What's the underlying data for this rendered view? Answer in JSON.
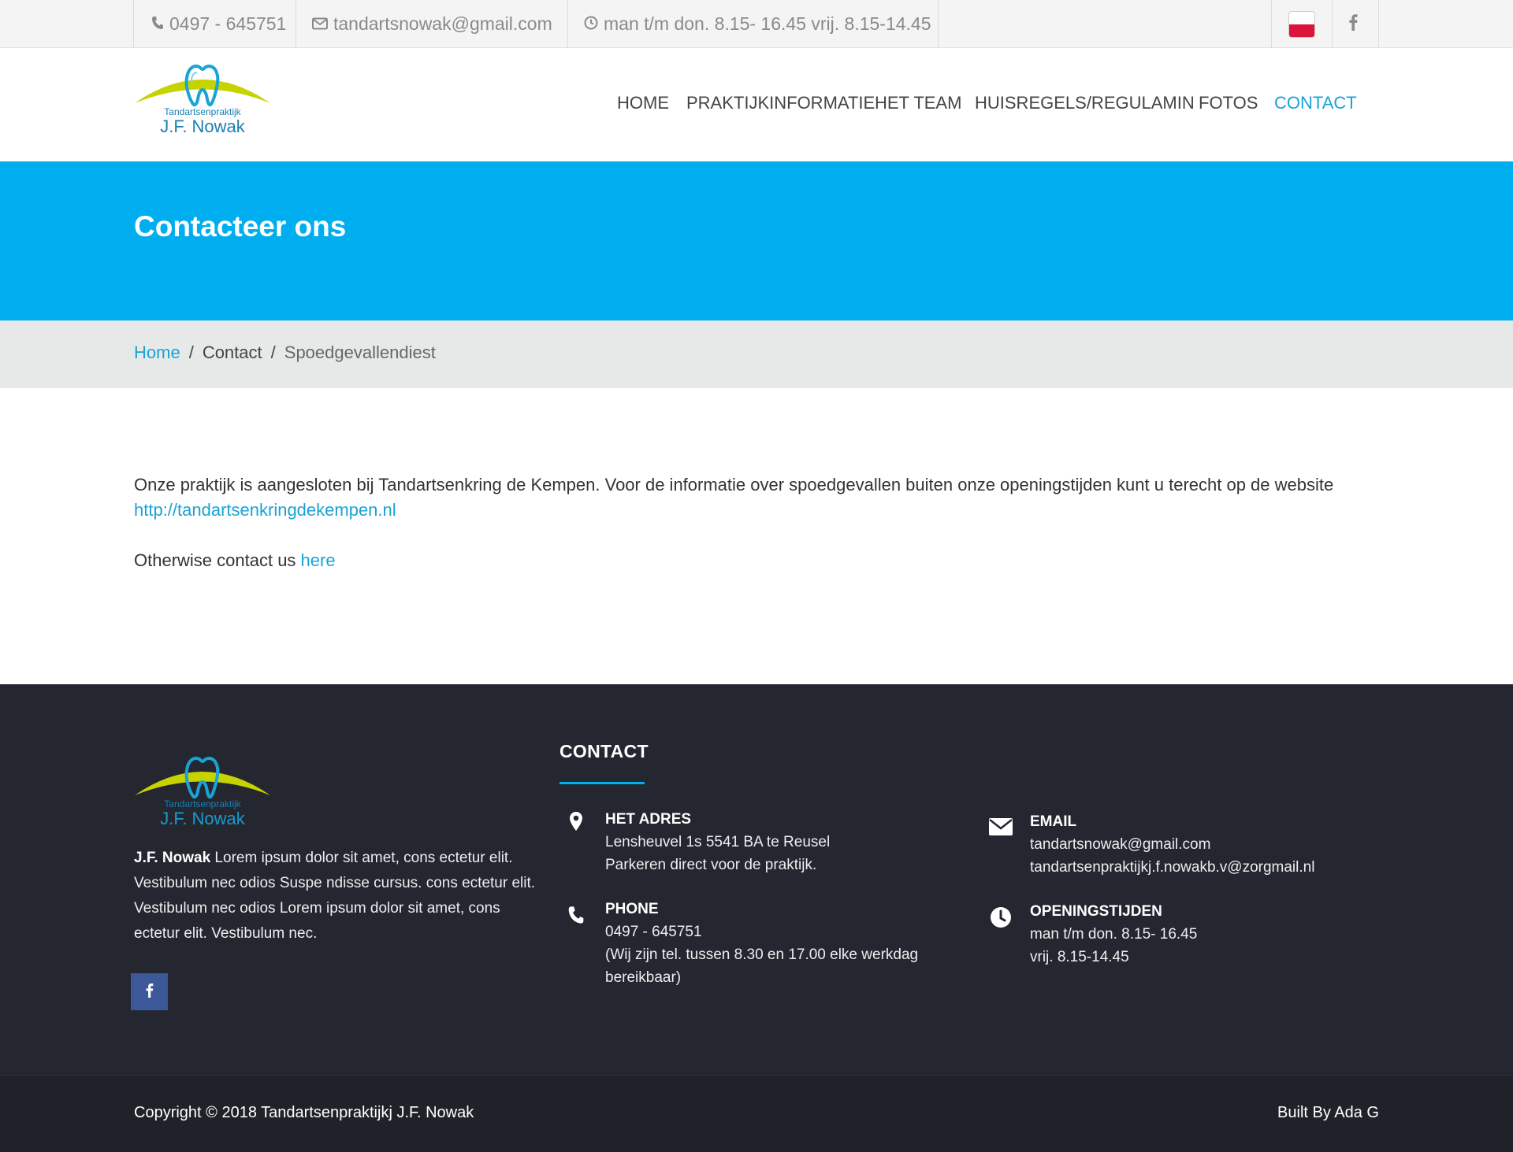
{
  "topbar": {
    "phone": "0497 - 645751",
    "email": "tandartsnowak@gmail.com",
    "hours": "man t/m don. 8.15- 16.45 vrij. 8.15-14.45",
    "phone_icon": "phone-icon",
    "email_icon": "envelope-icon",
    "hours_icon": "clock-icon",
    "language_flag": "poland-flag-icon",
    "social_icon": "facebook-icon"
  },
  "brand": {
    "logo_small": "Tandartsenpraktijk",
    "logo_name": "J.F. Nowak",
    "logo_colors": {
      "arc": "#c7d300",
      "tooth": "#1aa3d6",
      "text": "#1a7fb0"
    }
  },
  "nav": {
    "items": [
      {
        "label": "HOME"
      },
      {
        "label": "PRAKTIJKINFORMATIE"
      },
      {
        "label": "HET TEAM"
      },
      {
        "label": "HUISREGELS/REGULAMIN"
      },
      {
        "label": "FOTOS"
      },
      {
        "label": "CONTACT"
      }
    ],
    "active": "CONTACT"
  },
  "hero": {
    "title": "Contacteer ons",
    "color": "#00aeef"
  },
  "breadcrumb": {
    "home": "Home",
    "sep1": "/",
    "middle": "Contact",
    "sep2": "/",
    "current": "Spoedgevallendiest"
  },
  "content": {
    "paragraph1_text": "Onze praktijk is aangesloten bij Tandartsenkring de Kempen. Voor de informatie over spoedgevallen buiten onze openingstijden kunt u terecht op de website ",
    "paragraph1_link": "http://tandartsenkringdekempen.nl",
    "paragraph2_text": "Otherwise contact us ",
    "paragraph2_link": "here"
  },
  "footer": {
    "about_name": "J.F. Nowak",
    "about_text": " Lorem ipsum dolor sit amet, cons ectetur elit. Vestibulum nec odios Suspe ndisse cursus. cons ectetur elit. Vestibulum nec odios Lorem ipsum dolor sit amet, cons ectetur elit. Vestibulum nec.",
    "contact_heading": "CONTACT",
    "address": {
      "heading": "HET ADRES",
      "line1": "Lensheuvel 1s 5541 BA te Reusel",
      "line2": "Parkeren direct voor de praktijk.",
      "icon": "map-pin-icon"
    },
    "phone": {
      "heading": "PHONE",
      "line1": "0497 - 645751",
      "line2": "(Wij zijn tel. tussen 8.30 en 17.00 elke werkdag",
      "line3": "bereikbaar)",
      "icon": "phone-icon"
    },
    "email": {
      "heading": "EMAIL",
      "line1": "tandartsnowak@gmail.com",
      "line2": "tandartsenpraktijkj.f.nowakb.v@zorgmail.nl",
      "icon": "envelope-icon"
    },
    "hours": {
      "heading": "OPENINGSTIJDEN",
      "line1": "man t/m don. 8.15- 16.45",
      "line2": "vrij. 8.15-14.45",
      "icon": "clock-icon"
    },
    "copyright": "Copyright © 2018 Tandartsenpraktijkj J.F. Nowak",
    "built_by": "Built By Ada G"
  }
}
